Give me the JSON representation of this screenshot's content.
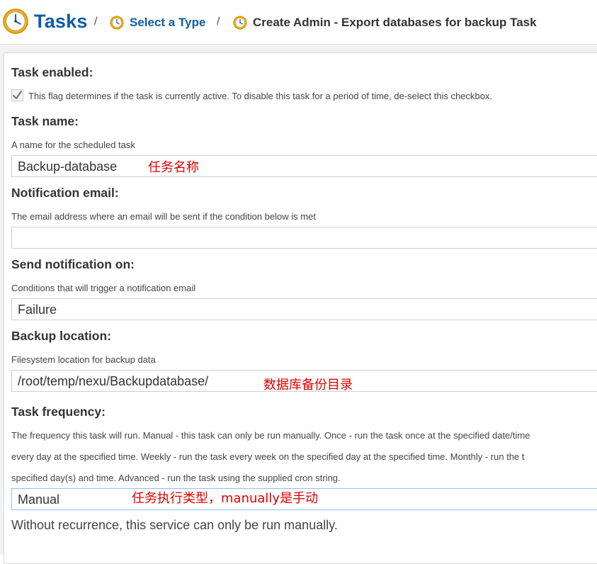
{
  "header": {
    "title": "Tasks",
    "separator": "/",
    "crumb_select": "Select a Type",
    "crumb_current": "Create Admin - Export databases for backup Task"
  },
  "form": {
    "task_enabled": {
      "label": "Task enabled:",
      "description": "This flag determines if the task is currently active. To disable this task for a period of time, de-select this checkbox.",
      "checked": true
    },
    "task_name": {
      "label": "Task name:",
      "description": "A name for the scheduled task",
      "value": "Backup-database",
      "annotation": "任务名称"
    },
    "notification_email": {
      "label": "Notification email:",
      "description": "The email address where an email will be sent if the condition below is met",
      "value": ""
    },
    "send_notification": {
      "label": "Send notification on:",
      "description": "Conditions that will trigger a notification email",
      "value": "Failure"
    },
    "backup_location": {
      "label": "Backup location:",
      "description": "Filesystem location for backup data",
      "value": "/root/temp/nexu/Backupdatabase/",
      "annotation": "数据库备份目录"
    },
    "task_frequency": {
      "label": "Task frequency:",
      "description_lines": [
        "The frequency this task will run. Manual - this task can only be run manually. Once - run the task once at the specified date/time",
        "every day at the specified time. Weekly - run the task every week on the specified day at the specified time. Monthly - run the t",
        "specified day(s) and time. Advanced - run the task using the supplied cron string."
      ],
      "value": "Manual",
      "annotation": "任务执行类型，manually是手动",
      "note": "Without recurrence, this service can only be run manually."
    }
  },
  "colors": {
    "link": "#0c5da5",
    "annotation": "#e00000",
    "panel_bg": "#f2f2f2"
  },
  "icons": {
    "title_icon": "clock-icon",
    "crumb_icon": "clock-icon",
    "checkbox_icon": "checkmark-icon"
  }
}
